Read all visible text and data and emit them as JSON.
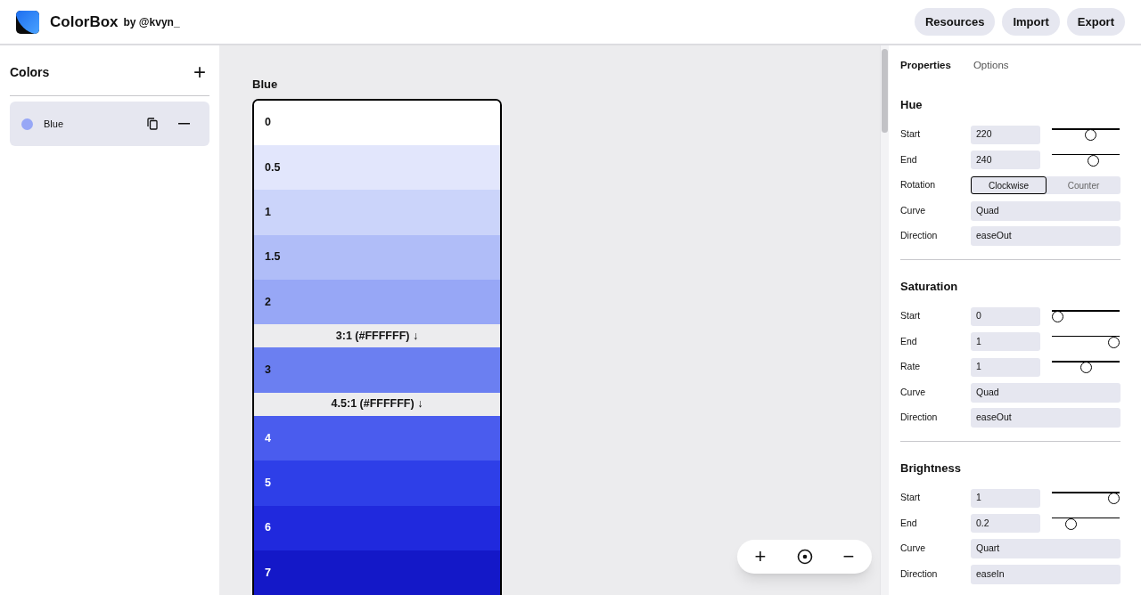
{
  "app": {
    "name": "ColorBox",
    "byline": "by @kvyn_"
  },
  "header_buttons": [
    "Resources",
    "Import",
    "Export"
  ],
  "sidebar": {
    "title": "Colors",
    "add": "+",
    "items": [
      {
        "name": "Blue",
        "color": "#97a7f6",
        "selected": true
      }
    ]
  },
  "canvas": {
    "palette_title": "Blue",
    "swatches": [
      {
        "kind": "swatch",
        "label": "0",
        "color": "#ffffff"
      },
      {
        "kind": "swatch",
        "label": "0.5",
        "color": "#e2e6fc"
      },
      {
        "kind": "swatch",
        "label": "1",
        "color": "#cbd4fa"
      },
      {
        "kind": "swatch",
        "label": "1.5",
        "color": "#b0bdf8"
      },
      {
        "kind": "swatch",
        "label": "2",
        "color": "#97a7f6"
      },
      {
        "kind": "contrast",
        "label": "3:1 (#FFFFFF) ↓"
      },
      {
        "kind": "swatch",
        "label": "3",
        "color": "#6b7ff1"
      },
      {
        "kind": "contrast",
        "label": "4.5:1 (#FFFFFF) ↓"
      },
      {
        "kind": "swatch",
        "label": "4",
        "color": "#4a5cee"
      },
      {
        "kind": "swatch",
        "label": "5",
        "color": "#2e3fe8"
      },
      {
        "kind": "swatch",
        "label": "6",
        "color": "#2029dd"
      },
      {
        "kind": "swatch",
        "label": "7",
        "color": "#1418c8"
      }
    ],
    "zoom_controls": [
      "+",
      "−"
    ]
  },
  "panel": {
    "tabs": [
      {
        "label": "Properties",
        "selected": true
      },
      {
        "label": "Options",
        "selected": false
      }
    ],
    "sections": [
      {
        "title": "Hue",
        "rows": [
          {
            "kind": "number",
            "label": "Start",
            "value": "220",
            "level": 0.59
          },
          {
            "kind": "number",
            "label": "End",
            "value": "240",
            "level": 0.64
          },
          {
            "kind": "toggle",
            "label": "Rotation",
            "options": [
              {
                "label": "Clockwise",
                "selected": true
              },
              {
                "label": "Counter",
                "selected": false
              }
            ]
          },
          {
            "kind": "select",
            "label": "Curve",
            "value": "Quad"
          },
          {
            "kind": "select",
            "label": "Direction",
            "value": "easeOut"
          }
        ]
      },
      {
        "title": "Saturation",
        "rows": [
          {
            "kind": "number",
            "label": "Start",
            "value": "0",
            "level": 0
          },
          {
            "kind": "number",
            "label": "End",
            "value": "1",
            "level": 1
          },
          {
            "kind": "number",
            "label": "Rate",
            "value": "1",
            "level": 0.5
          },
          {
            "kind": "select",
            "label": "Curve",
            "value": "Quad"
          },
          {
            "kind": "select",
            "label": "Direction",
            "value": "easeOut"
          }
        ]
      },
      {
        "title": "Brightness",
        "rows": [
          {
            "kind": "number",
            "label": "Start",
            "value": "1",
            "level": 1
          },
          {
            "kind": "number",
            "label": "End",
            "value": "0.2",
            "level": 0.24
          },
          {
            "kind": "select",
            "label": "Curve",
            "value": "Quart"
          },
          {
            "kind": "select",
            "label": "Direction",
            "value": "easeIn"
          }
        ]
      }
    ]
  }
}
